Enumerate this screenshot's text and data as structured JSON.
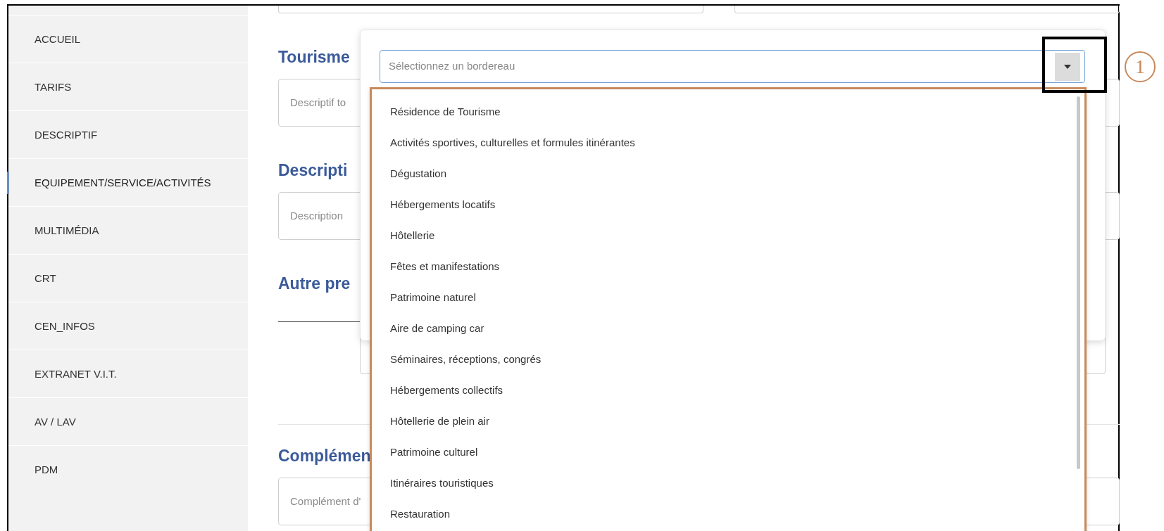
{
  "sidebar": {
    "items": [
      {
        "label": "ACCUEIL",
        "selected": false
      },
      {
        "label": "TARIFS",
        "selected": false
      },
      {
        "label": "DESCRIPTIF",
        "selected": false
      },
      {
        "label": "EQUIPEMENT/SERVICE/ACTIVITÉS",
        "selected": true
      },
      {
        "label": "MULTIMÉDIA",
        "selected": false
      },
      {
        "label": "CRT",
        "selected": false
      },
      {
        "label": "CEN_INFOS",
        "selected": false
      },
      {
        "label": "EXTRANET V.I.T.",
        "selected": false
      },
      {
        "label": "AV / LAV",
        "selected": false
      },
      {
        "label": "PDM",
        "selected": false
      }
    ]
  },
  "form": {
    "sections": [
      {
        "kind": "field",
        "heading": "Tourisme",
        "placeholder": "Descriptif to"
      },
      {
        "kind": "field",
        "heading": "Descripti",
        "placeholder": "Description"
      },
      {
        "kind": "rule",
        "heading": "Autre pre"
      },
      {
        "kind": "field",
        "heading": "Complémen",
        "placeholder": "Complément d'"
      }
    ]
  },
  "dropdown": {
    "placeholder": "Sélectionnez un bordereau",
    "expanded": true,
    "options": [
      "Résidence de Tourisme",
      "Activités sportives, culturelles et formules itinérantes",
      "Dégustation",
      "Hébergements locatifs",
      "Hôtellerie",
      "Fêtes et manifestations",
      "Patrimoine naturel",
      "Aire de camping car",
      "Séminaires, réceptions, congrés",
      "Hébergements collectifs",
      "Hôtellerie de plein air",
      "Patrimoine culturel",
      "Itinéraires touristiques",
      "Restauration"
    ]
  },
  "annotation": {
    "label": "1"
  }
}
